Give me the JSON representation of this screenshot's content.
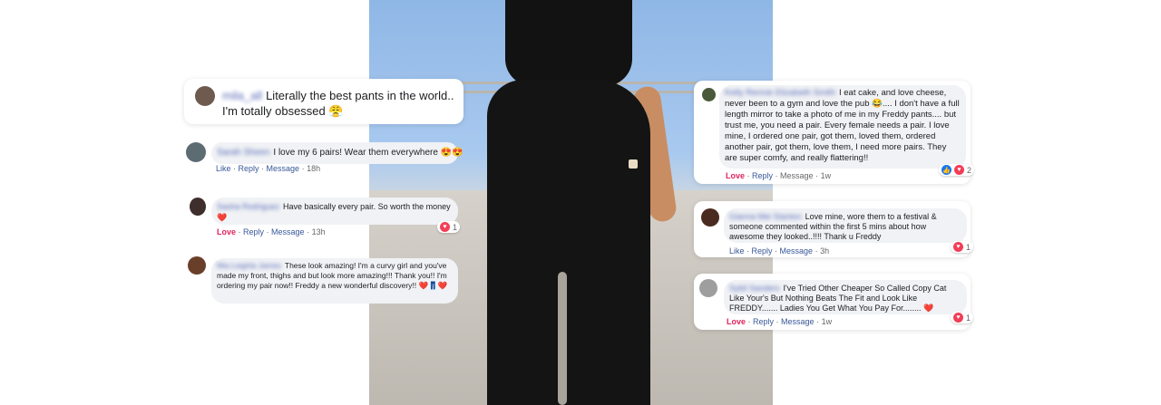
{
  "comments": [
    {
      "name": "mila_all",
      "text": "Literally the best pants in the world.. I'm totally obsessed",
      "emoji": "😤"
    },
    {
      "name": "Sarah Sheen",
      "text": "I love my 6 pairs! Wear them everywhere",
      "emoji": "😍😍",
      "actions": {
        "like": "Like",
        "reply": "Reply",
        "message": "Message",
        "time": "18h"
      }
    },
    {
      "name": "Sasha Rodriguez",
      "text": "Have basically every pair. So worth the money",
      "emoji": "❤️",
      "actions": {
        "like": "Love",
        "reply": "Reply",
        "message": "Message",
        "time": "13h"
      },
      "reactions": "1"
    },
    {
      "name": "Mia Leighla James",
      "text": "These look amazing! I'm a curvy girl and you've made my front, thighs and but look more amazing!!! Thank you!! I'm ordering my pair now!! Freddy a new wonderful discovery!!",
      "emoji": "❤️👖❤️"
    },
    {
      "name": "Kelly Rennie Elizabeth Smith",
      "text": "I eat cake, and love cheese, never been to a gym and love the pub 😂.... I don't have a full length mirror to take a photo of me in my Freddy pants.... but trust me, you need a pair. Every female needs a pair. I love mine, I ordered one pair, got them, loved them, ordered another pair, got them, love them, I need more pairs. They are super comfy, and really flattering!!",
      "actions": {
        "like": "Love",
        "reply": "Reply",
        "message": "Message",
        "time": "1w"
      },
      "reactions": "2"
    },
    {
      "name": "Gianna Mei Stanton",
      "text": "Love mine, wore them to a festival & someone commented within the first 5 mins about how awesome they looked..!!!! Thank u Freddy",
      "actions": {
        "like": "Like",
        "reply": "Reply",
        "message": "Message",
        "time": "3h"
      },
      "reactions": "1"
    },
    {
      "name": "Sybil Sanders",
      "text": "I've Tried Other Cheaper So Called Copy Cat Like Your's But Nothing Beats The Fit and Look Like FREDDY....... Ladies You Get What You Pay For........",
      "emoji": "❤️",
      "actions": {
        "like": "Love",
        "reply": "Reply",
        "message": "Message",
        "time": "1w"
      },
      "reactions": "1"
    }
  ]
}
